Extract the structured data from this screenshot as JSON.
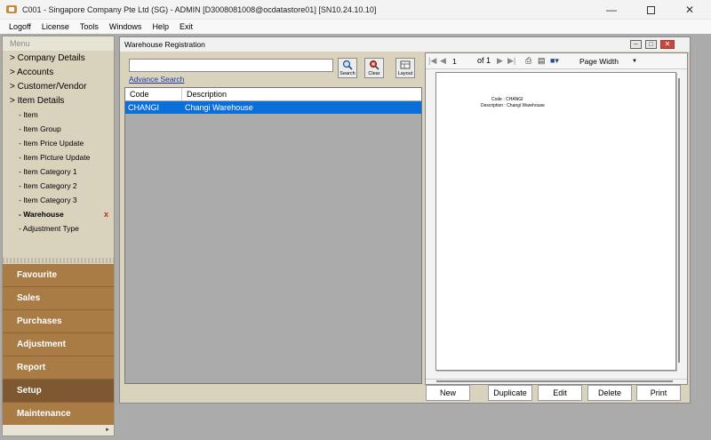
{
  "window": {
    "title": "C001 - Singapore Company Pte Ltd (SG) - ADMIN [D3008081008@ocdatastore01] [SN10.24.10.10]"
  },
  "menubar": [
    "Logoff",
    "License",
    "Tools",
    "Windows",
    "Help",
    "Exit"
  ],
  "sidebar": {
    "header": "Menu",
    "top_items": [
      {
        "label": "> Company Details"
      },
      {
        "label": "> Accounts"
      },
      {
        "label": "> Customer/Vendor"
      },
      {
        "label": "> Item Details"
      }
    ],
    "sub_items": [
      {
        "label": "- Item"
      },
      {
        "label": "- Item Group"
      },
      {
        "label": "- Item Price Update"
      },
      {
        "label": "- Item Picture Update"
      },
      {
        "label": "- Item Category 1"
      },
      {
        "label": "- Item Category 2"
      },
      {
        "label": "- Item Category 3"
      },
      {
        "label": "- Warehouse",
        "active": true
      },
      {
        "label": "- Adjustment Type"
      }
    ],
    "close_mark": "x",
    "modules": [
      "Favourite",
      "Sales",
      "Purchases",
      "Adjustment",
      "Report",
      "Setup",
      "Maintenance"
    ],
    "active_module": "Setup"
  },
  "child_window": {
    "title": "Warehouse Registration"
  },
  "search": {
    "value": "",
    "advance_link": "Advance Search",
    "search_label": "Search",
    "clear_label": "Clear",
    "layout_label": "Layout"
  },
  "grid": {
    "columns": [
      "Code",
      "Description"
    ],
    "rows": [
      {
        "code": "CHANGI",
        "description": "Changi Warehouse",
        "selected": true
      }
    ]
  },
  "preview": {
    "page": "1",
    "of_label": "of 1",
    "zoom": "Page Width",
    "report_lines": [
      "Code : CHANGI",
      "Description : Changi Warehouse"
    ]
  },
  "actions": [
    "New",
    "Duplicate",
    "Edit",
    "Delete",
    "Print"
  ],
  "colors": {
    "module_bg": "#a97b45",
    "module_active": "#7e5830",
    "selection": "#0a6fd8",
    "link": "#1a3a9e"
  }
}
